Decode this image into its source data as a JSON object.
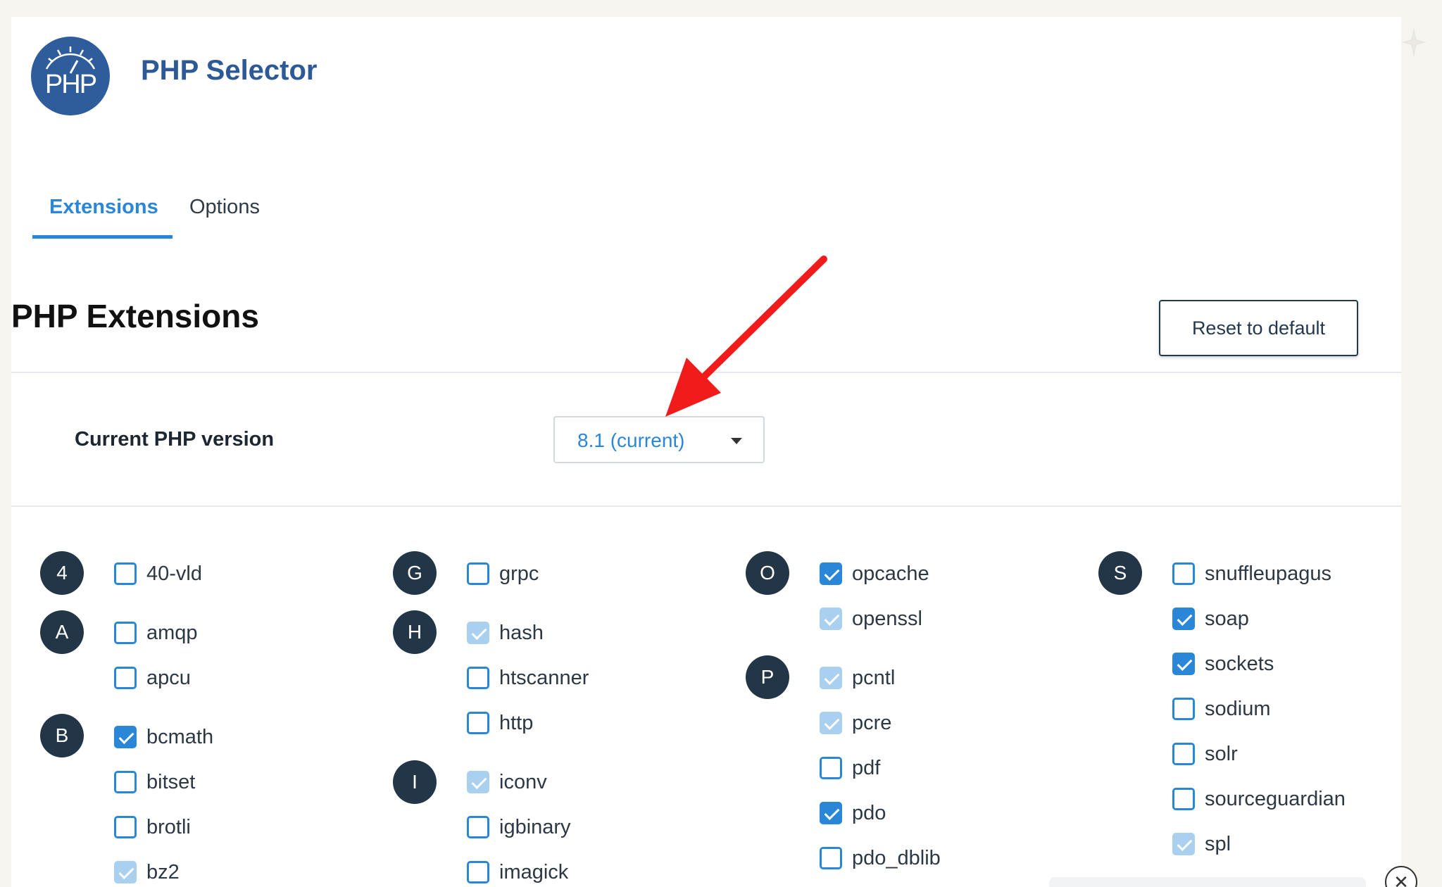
{
  "app": {
    "title": "PHP Selector",
    "logo_text": "PHP",
    "logo_color": "#2f5d9c"
  },
  "tabs": [
    {
      "label": "Extensions",
      "active": true
    },
    {
      "label": "Options",
      "active": false
    }
  ],
  "section": {
    "title": "PHP Extensions",
    "reset_label": "Reset to default"
  },
  "version": {
    "label": "Current PHP version",
    "selected": "8.1 (current)"
  },
  "annotation": {
    "type": "red-arrow",
    "color": "#f21b1b",
    "points_to": "version-select"
  },
  "letters": [
    "4",
    "A",
    "B",
    "G",
    "H",
    "I",
    "O",
    "P",
    "S"
  ],
  "extensions": [
    {
      "name": "40-vld",
      "state": "unchecked"
    },
    {
      "name": "amqp",
      "state": "unchecked"
    },
    {
      "name": "apcu",
      "state": "unchecked"
    },
    {
      "name": "bcmath",
      "state": "checked"
    },
    {
      "name": "bitset",
      "state": "unchecked"
    },
    {
      "name": "brotli",
      "state": "unchecked"
    },
    {
      "name": "bz2",
      "state": "default"
    },
    {
      "name": "grpc",
      "state": "unchecked"
    },
    {
      "name": "hash",
      "state": "default"
    },
    {
      "name": "htscanner",
      "state": "unchecked"
    },
    {
      "name": "http",
      "state": "unchecked"
    },
    {
      "name": "iconv",
      "state": "default"
    },
    {
      "name": "igbinary",
      "state": "unchecked"
    },
    {
      "name": "imagick",
      "state": "unchecked"
    },
    {
      "name": "opcache",
      "state": "checked"
    },
    {
      "name": "openssl",
      "state": "default"
    },
    {
      "name": "pcntl",
      "state": "default"
    },
    {
      "name": "pcre",
      "state": "default"
    },
    {
      "name": "pdf",
      "state": "unchecked"
    },
    {
      "name": "pdo",
      "state": "checked"
    },
    {
      "name": "pdo_dblib",
      "state": "unchecked"
    },
    {
      "name": "snuffleupagus",
      "state": "unchecked"
    },
    {
      "name": "soap",
      "state": "checked"
    },
    {
      "name": "sockets",
      "state": "checked"
    },
    {
      "name": "sodium",
      "state": "unchecked"
    },
    {
      "name": "solr",
      "state": "unchecked"
    },
    {
      "name": "sourceguardian",
      "state": "unchecked"
    },
    {
      "name": "spl",
      "state": "default"
    }
  ],
  "help": {
    "icon": "close-icon",
    "glyph": "✕"
  }
}
